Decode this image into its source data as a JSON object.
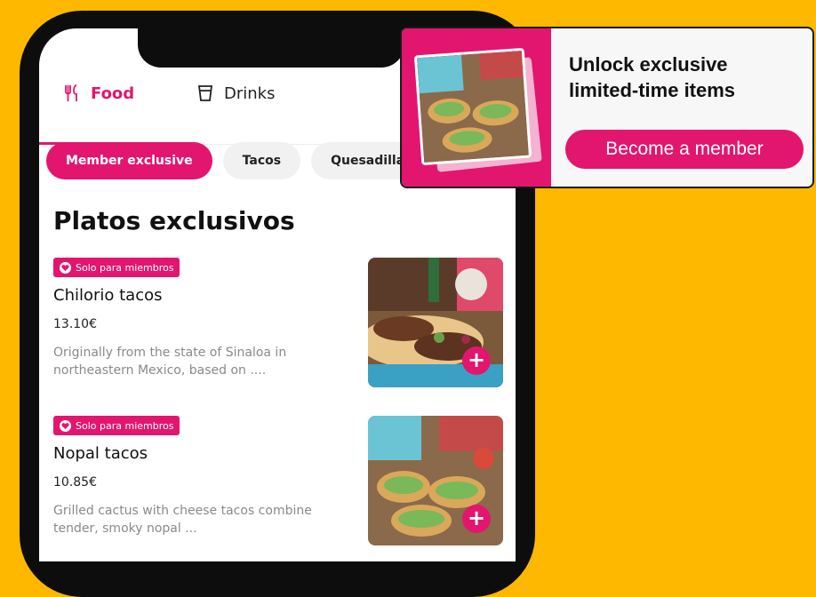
{
  "tabs": [
    {
      "label": "Food",
      "icon": "fork-knife-icon"
    },
    {
      "label": "Drinks",
      "icon": "glass-icon"
    }
  ],
  "chips": [
    "Member exclusive",
    "Tacos",
    "Quesadillas"
  ],
  "section_title": "Platos exclusivos",
  "items": [
    {
      "badge": "Solo para miembros",
      "name": "Chilorio tacos",
      "price": "13.10€",
      "description": "Originally from the state of Sinaloa in northeastern Mexico, based on ....",
      "image": "chilorio-tacos-photo"
    },
    {
      "badge": "Solo para miembros",
      "name": "Nopal tacos",
      "price": "10.85€",
      "description": "Grilled cactus with cheese tacos combine tender, smoky nopal ...",
      "image": "nopal-tacos-photo"
    }
  ],
  "promo": {
    "title": "Unlock exclusive limited-time items",
    "button": "Become a member"
  },
  "colors": {
    "accent": "#E2166E",
    "background": "#FFB800"
  }
}
